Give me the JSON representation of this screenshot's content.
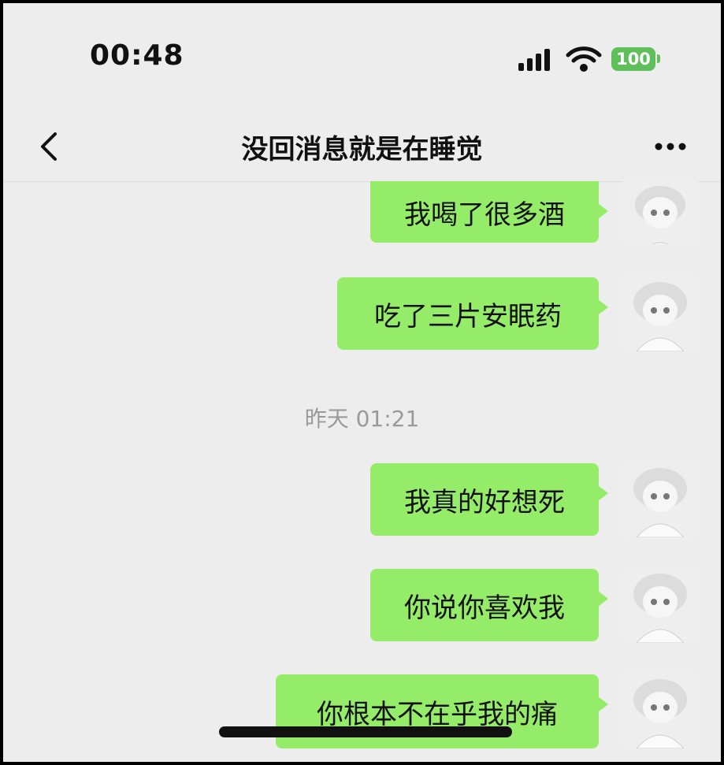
{
  "status_bar": {
    "time": "00:48",
    "battery": "100",
    "signal_icon": "cellular-signal-icon",
    "wifi_icon": "wifi-icon"
  },
  "nav": {
    "title": "没回消息就是在睡觉",
    "back_icon": "chevron-left-icon",
    "more_icon": "more-dots-icon"
  },
  "messages": [
    {
      "text": "我喝了很多酒"
    },
    {
      "text": "吃了三片安眠药"
    },
    {
      "text": "我真的好想死"
    },
    {
      "text": "你说你喜欢我"
    },
    {
      "text": "你根本不在乎我的痛"
    }
  ],
  "timestamp": "昨天 01:21",
  "colors": {
    "bubble": "#95ec69",
    "background": "#ededed",
    "battery": "#5fbf5a"
  }
}
